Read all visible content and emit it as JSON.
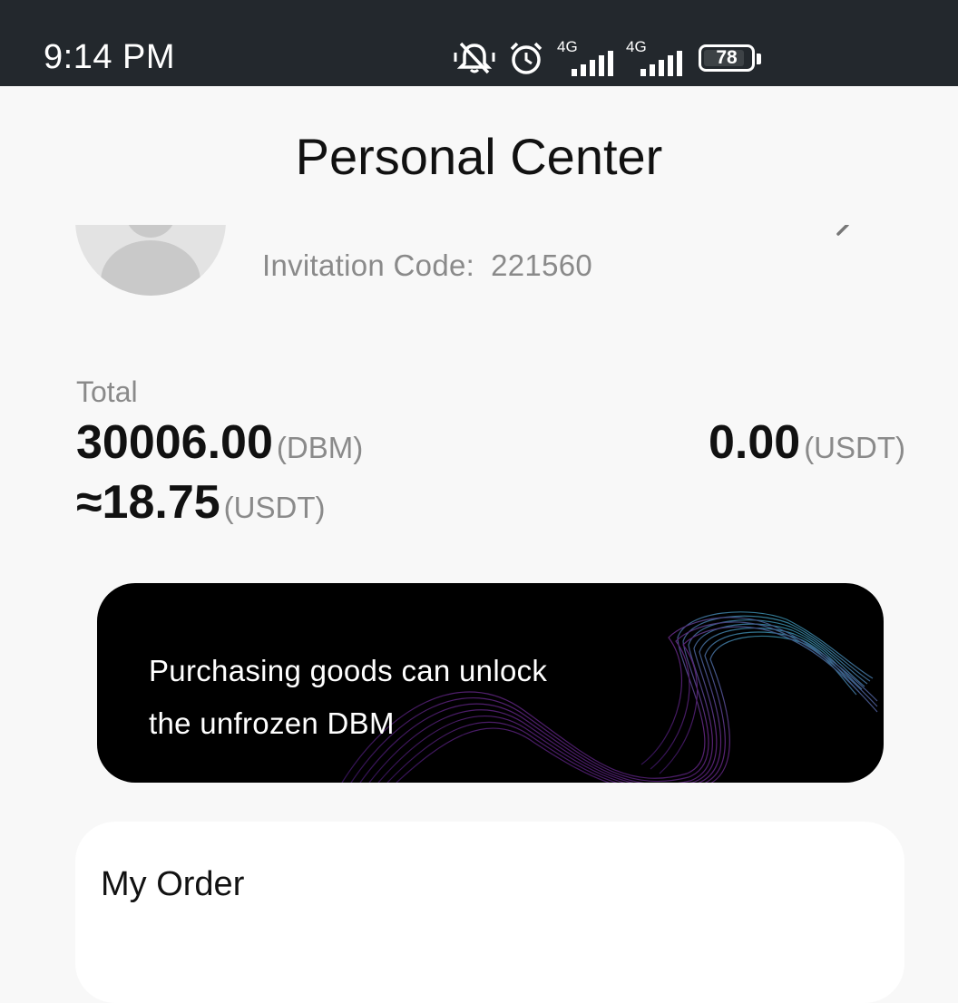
{
  "status_bar": {
    "time": "9:14 PM",
    "network_1": "4G",
    "network_2": "4G",
    "battery": "78",
    "icons": [
      "bell-muted-icon",
      "alarm-icon",
      "signal-icon",
      "signal-icon",
      "battery-icon"
    ]
  },
  "header": {
    "title": "Personal Center"
  },
  "profile": {
    "invitation_label": "Invitation Code:",
    "invitation_code": "221560"
  },
  "balance": {
    "total_label": "Total",
    "dbm_amount": "30006.00",
    "dbm_unit": "(DBM)",
    "approx_amount": "≈18.75",
    "approx_unit": "(USDT)",
    "usdt_amount": "0.00",
    "usdt_unit": "(USDT)"
  },
  "banner": {
    "line1": "Purchasing goods can unlock",
    "line2": "the unfrozen DBM"
  },
  "orders": {
    "title": "My Order"
  },
  "colors": {
    "status_bar_bg": "#23282d",
    "page_bg": "#f8f8f8",
    "banner_bg": "#000000",
    "text_primary": "#111111",
    "text_secondary": "#8a8a8a"
  }
}
